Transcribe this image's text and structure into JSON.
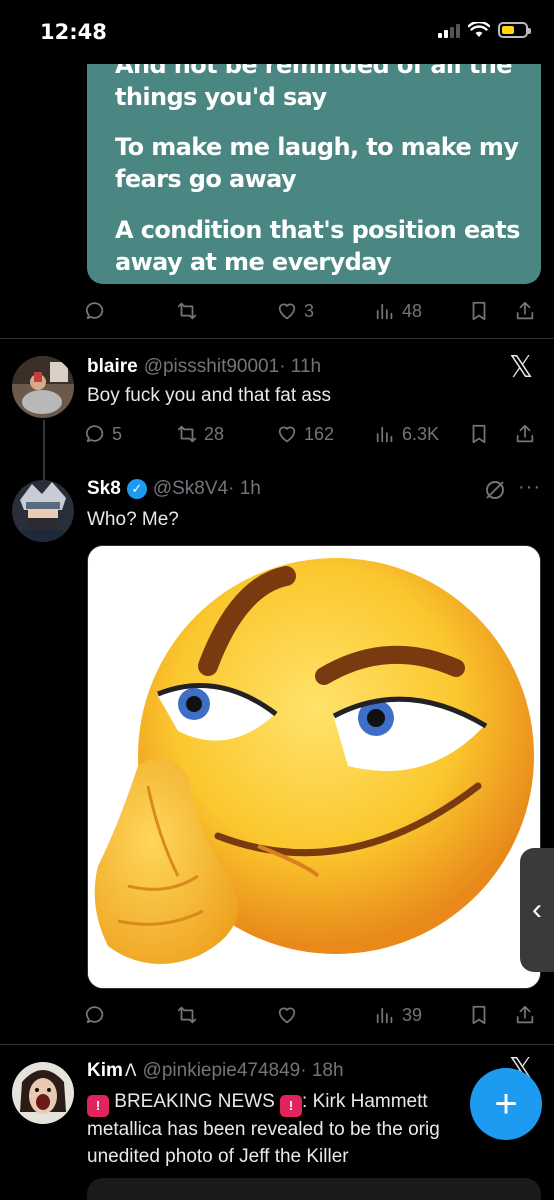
{
  "status_bar": {
    "time": "12:48"
  },
  "lyric_card": {
    "lines": [
      "And not be reminded of all the",
      "things you'd say",
      "To make me laugh, to make my",
      "fears go away",
      "A condition that's position eats",
      "away at me everyday"
    ]
  },
  "tweet0": {
    "likes": "3",
    "views": "48"
  },
  "tweet1": {
    "name": "blaire",
    "handle": "@pissshit90001",
    "time": "· 11h",
    "text": "Boy fuck you and that fat ass",
    "replies": "5",
    "retweets": "28",
    "likes": "162",
    "views": "6.3K"
  },
  "tweet2": {
    "name": "Sk8",
    "handle": "@Sk8V4",
    "time": "· 1h",
    "text": "Who? Me?",
    "views": "39"
  },
  "tweet3": {
    "name": "Kim",
    "handle": "@pinkiepie474849",
    "time": "· 18h",
    "breaking": "BREAKING NEWS",
    "text_after": ": Kirk Hammett",
    "line2": "metallica has been revealed to be the orig",
    "line3": "unedited photo of Jeff the Killer"
  },
  "icons": {
    "reply": "reply-icon",
    "retweet": "retweet-icon",
    "like": "heart-icon",
    "views": "views-icon",
    "bookmark": "bookmark-icon",
    "share": "share-icon",
    "x_logo": "x-logo-icon",
    "compose": "plus-icon",
    "grok": "grok-icon",
    "more": "more-icon",
    "siren": "siren-emoji-icon",
    "rose": "rose-emoji-icon"
  },
  "colors": {
    "accent": "#1d9bf0",
    "card": "#4a8783",
    "muted": "#71767b"
  }
}
